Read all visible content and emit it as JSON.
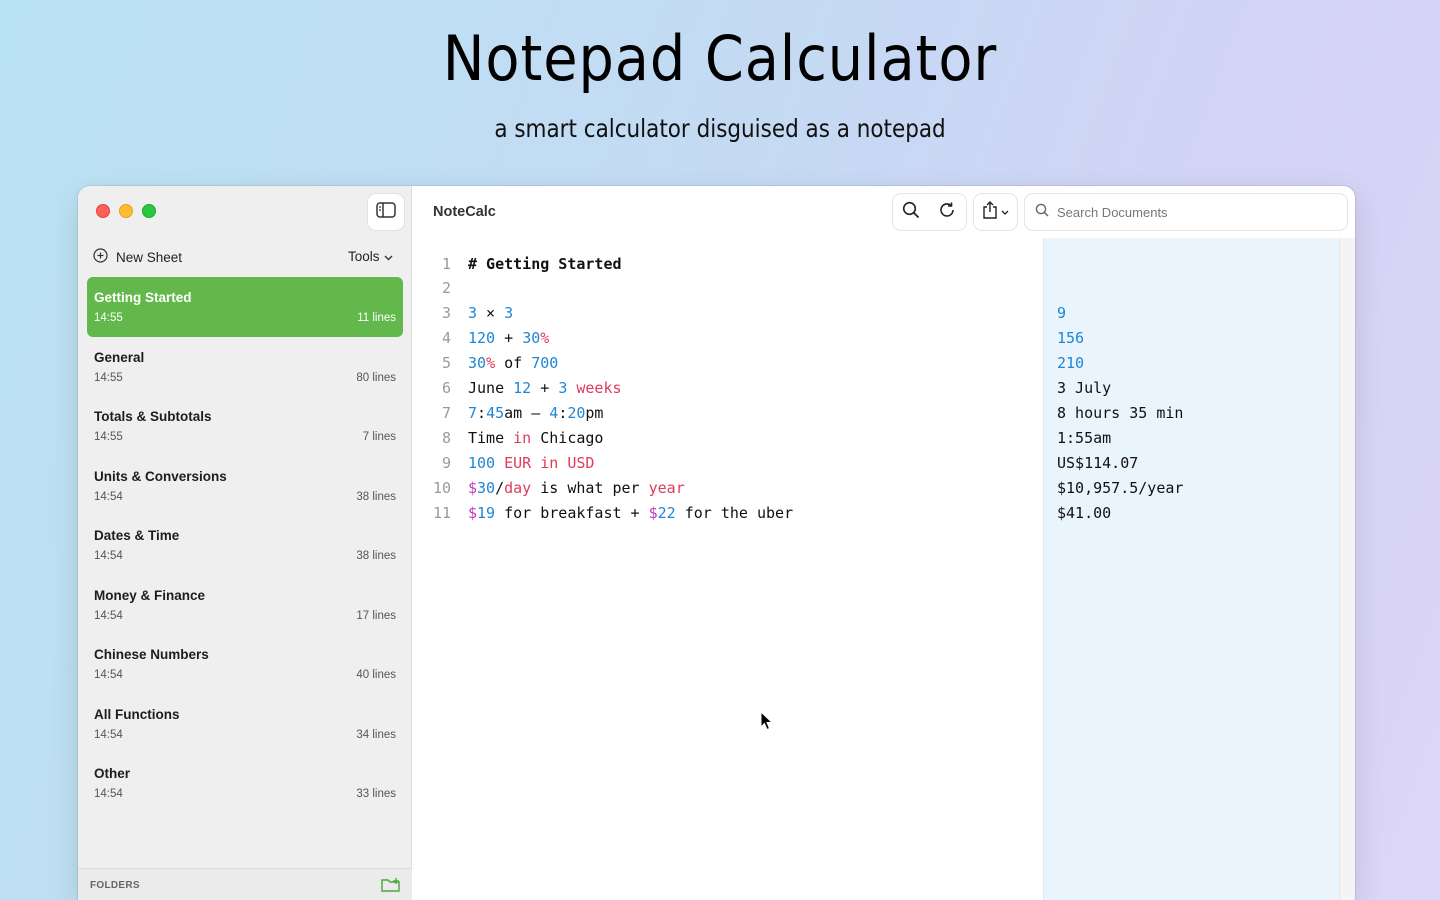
{
  "hero": {
    "title": "Notepad Calculator",
    "subtitle": "a smart calculator disguised as a notepad"
  },
  "sidebar": {
    "new_sheet": "New Sheet",
    "tools": "Tools",
    "sheets": [
      {
        "title": "Getting Started",
        "time": "14:55",
        "lines": "11 lines",
        "active": true
      },
      {
        "title": "General",
        "time": "14:55",
        "lines": "80 lines"
      },
      {
        "title": "Totals & Subtotals",
        "time": "14:55",
        "lines": "7 lines"
      },
      {
        "title": "Units & Conversions",
        "time": "14:54",
        "lines": "38 lines"
      },
      {
        "title": "Dates & Time",
        "time": "14:54",
        "lines": "38 lines"
      },
      {
        "title": "Money & Finance",
        "time": "14:54",
        "lines": "17 lines"
      },
      {
        "title": "Chinese Numbers",
        "time": "14:54",
        "lines": "40 lines"
      },
      {
        "title": "All Functions",
        "time": "14:54",
        "lines": "34 lines"
      },
      {
        "title": "Other",
        "time": "14:54",
        "lines": "33 lines"
      }
    ],
    "folders_label": "FOLDERS"
  },
  "toolbar": {
    "app_title": "NoteCalc",
    "search_placeholder": "Search Documents"
  },
  "editor": {
    "line_numbers": [
      "1",
      "2",
      "3",
      "4",
      "5",
      "6",
      "7",
      "8",
      "9",
      "10",
      "11"
    ],
    "lines": [
      [
        {
          "t": "# Getting Started",
          "c": "head"
        }
      ],
      [],
      [
        {
          "t": "3",
          "c": "num"
        },
        {
          "t": " × "
        },
        {
          "t": "3",
          "c": "num"
        }
      ],
      [
        {
          "t": "120",
          "c": "num"
        },
        {
          "t": " + "
        },
        {
          "t": "30",
          "c": "num"
        },
        {
          "t": "%",
          "c": "unit"
        }
      ],
      [
        {
          "t": "30",
          "c": "num"
        },
        {
          "t": "%",
          "c": "unit"
        },
        {
          "t": " of "
        },
        {
          "t": "700",
          "c": "num"
        }
      ],
      [
        {
          "t": "June "
        },
        {
          "t": "12",
          "c": "num"
        },
        {
          "t": " + "
        },
        {
          "t": "3",
          "c": "num"
        },
        {
          "t": " weeks",
          "c": "unit"
        }
      ],
      [
        {
          "t": "7",
          "c": "num"
        },
        {
          "t": ":"
        },
        {
          "t": "45",
          "c": "num"
        },
        {
          "t": "am – "
        },
        {
          "t": "4",
          "c": "num"
        },
        {
          "t": ":"
        },
        {
          "t": "20",
          "c": "num"
        },
        {
          "t": "pm"
        }
      ],
      [
        {
          "t": "Time "
        },
        {
          "t": "in",
          "c": "kw"
        },
        {
          "t": " Chicago"
        }
      ],
      [
        {
          "t": "100",
          "c": "num"
        },
        {
          "t": " EUR",
          "c": "unit"
        },
        {
          "t": " in",
          "c": "kw"
        },
        {
          "t": " USD",
          "c": "unit"
        }
      ],
      [
        {
          "t": "$",
          "c": "cur"
        },
        {
          "t": "30",
          "c": "num"
        },
        {
          "t": "/"
        },
        {
          "t": "day",
          "c": "unit"
        },
        {
          "t": " is what per "
        },
        {
          "t": "year",
          "c": "unit"
        }
      ],
      [
        {
          "t": "$",
          "c": "cur"
        },
        {
          "t": "19",
          "c": "num"
        },
        {
          "t": " for breakfast + "
        },
        {
          "t": "$",
          "c": "cur"
        },
        {
          "t": "22",
          "c": "num"
        },
        {
          "t": " for the uber"
        }
      ]
    ]
  },
  "results": [
    {
      "line": 3,
      "value": "9",
      "num": true
    },
    {
      "line": 4,
      "value": "156",
      "num": true
    },
    {
      "line": 5,
      "value": "210",
      "num": true
    },
    {
      "line": 6,
      "value": "3 July"
    },
    {
      "line": 7,
      "value": "8 hours 35 min"
    },
    {
      "line": 8,
      "value": "1:55am"
    },
    {
      "line": 9,
      "value": "US$114.07"
    },
    {
      "line": 10,
      "value": "$10,957.5/year"
    },
    {
      "line": 11,
      "value": "$41.00"
    }
  ]
}
